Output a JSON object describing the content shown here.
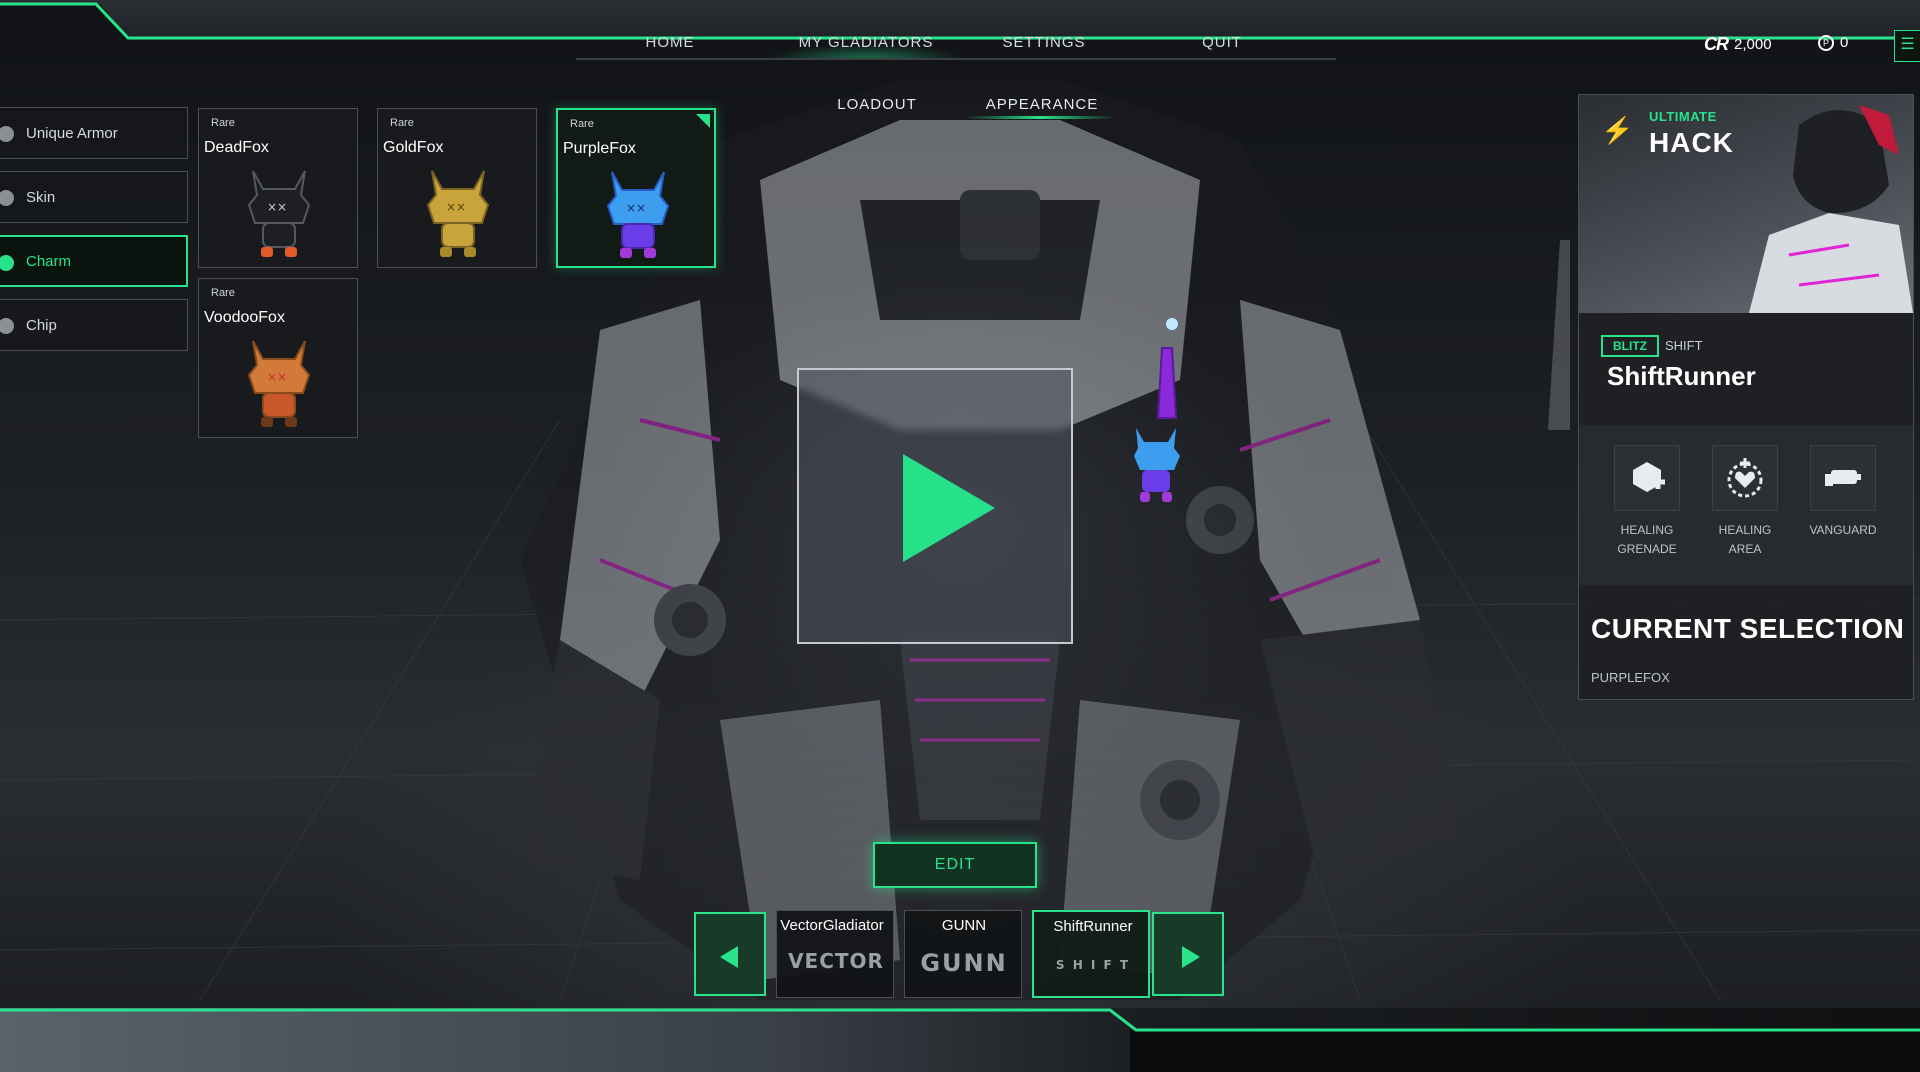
{
  "topnav": {
    "items": [
      {
        "label": "HOME"
      },
      {
        "label": "MY GLADIATORS"
      },
      {
        "label": "SETTINGS"
      },
      {
        "label": "QUIT"
      }
    ]
  },
  "subnav": {
    "items": [
      {
        "label": "LOADOUT"
      },
      {
        "label": "APPEARANCE"
      }
    ]
  },
  "currency": {
    "credits_value": "2,000",
    "premium_value": "0",
    "credits_icon": "cr-logo-icon",
    "premium_icon": "token-icon"
  },
  "categories": [
    {
      "label": "Unique Armor",
      "active": false
    },
    {
      "label": "Skin",
      "active": false
    },
    {
      "label": "Charm",
      "active": true
    },
    {
      "label": "Chip",
      "active": false
    }
  ],
  "items": [
    {
      "rarity": "Rare",
      "name": "DeadFox",
      "color": "#1e1f22",
      "selected": false
    },
    {
      "rarity": "Rare",
      "name": "GoldFox",
      "color": "#c8a43a",
      "selected": false
    },
    {
      "rarity": "Rare",
      "name": "PurpleFox",
      "color": "#3d7de8",
      "selected": true
    },
    {
      "rarity": "Rare",
      "name": "VoodooFox",
      "color": "#d27a3a",
      "selected": false
    }
  ],
  "edit_button": {
    "label": "EDIT"
  },
  "gladiators": [
    {
      "name": "VectorGladiator",
      "logo": "VECTOR",
      "selected": false
    },
    {
      "name": "GUNN",
      "logo": "GUNN",
      "selected": false
    },
    {
      "name": "ShiftRunner",
      "logo": "S H I F T",
      "selected": true
    }
  ],
  "panel": {
    "ultimate_label": "ULTIMATE",
    "ultimate_name": "HACK",
    "class_badge": "BLITZ",
    "class_sub": "SHIFT",
    "gladiator_name": "ShiftRunner",
    "abilities": [
      {
        "label_line1": "HEALING",
        "label_line2": "GRENADE",
        "icon": "healing-grenade-icon"
      },
      {
        "label_line1": "HEALING",
        "label_line2": "AREA",
        "icon": "healing-area-icon"
      },
      {
        "label_line1": "VANGUARD",
        "label_line2": "",
        "icon": "vanguard-icon"
      }
    ],
    "current_selection_title": "CURRENT SELECTION",
    "current_selection_value": "PURPLEFOX"
  },
  "colors": {
    "accent": "#29e38b",
    "panel_bg": "#1e2023",
    "border": "#4a4f55"
  }
}
